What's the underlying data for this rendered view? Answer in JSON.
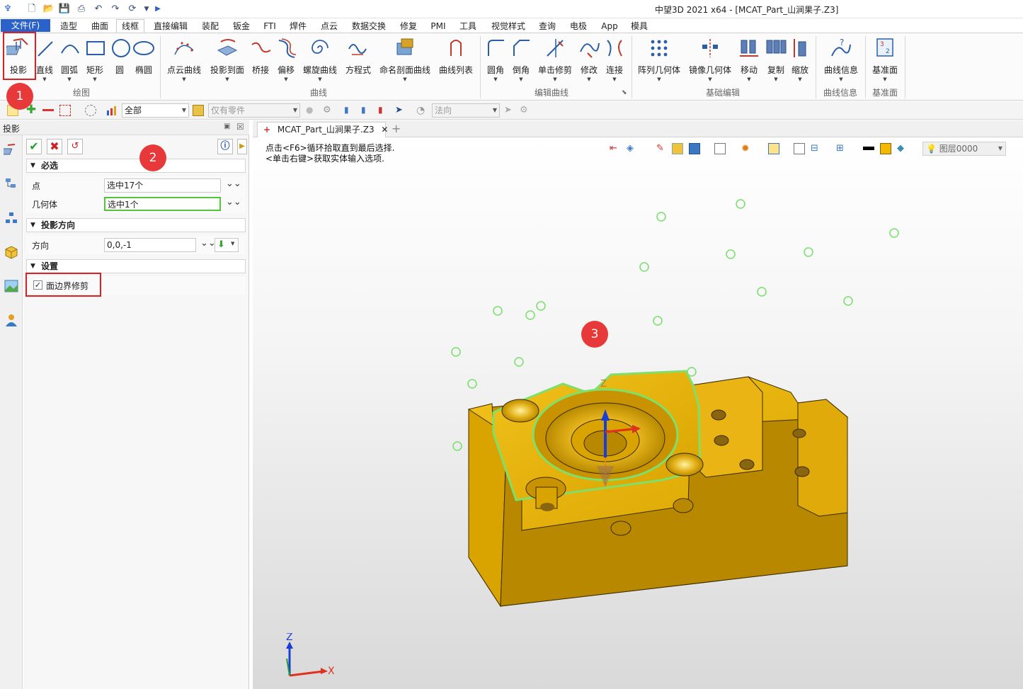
{
  "window": {
    "title": "中望3D 2021 x64 - [MCAT_Part_山涧果子.Z3]"
  },
  "menu": {
    "file": "文件(F)",
    "items": [
      "造型",
      "曲面",
      "线框",
      "直接编辑",
      "装配",
      "钣金",
      "FTI",
      "焊件",
      "点云",
      "数据交换",
      "修复",
      "PMI",
      "工具",
      "视觉样式",
      "查询",
      "电极",
      "App",
      "模具"
    ],
    "active": "线框"
  },
  "ribbon": {
    "groups": {
      "draw": {
        "label": "绘图",
        "buttons": [
          "投影",
          "直线",
          "圆弧",
          "矩形",
          "圆",
          "椭圆"
        ]
      },
      "curve": {
        "label": "曲线",
        "buttons": [
          "点云曲线",
          "投影到面",
          "桥接",
          "偏移",
          "螺旋曲线",
          "方程式",
          "命名剖面曲线",
          "曲线列表"
        ]
      },
      "edit": {
        "label": "编辑曲线",
        "buttons": [
          "圆角",
          "倒角",
          "单击修剪",
          "修改",
          "连接"
        ]
      },
      "basic": {
        "label": "基础编辑",
        "buttons": [
          "阵列几何体",
          "镜像几何体",
          "移动",
          "复制",
          "缩放"
        ]
      },
      "info": {
        "label": "曲线信息",
        "buttons": [
          "曲线信息"
        ]
      },
      "plane": {
        "label": "基准面",
        "buttons": [
          "基准面"
        ]
      }
    }
  },
  "toolbar": {
    "filter_value": "全部",
    "scope_value": "仅有零件",
    "direction_value": "法向"
  },
  "panel": {
    "title": "投影",
    "sections": {
      "required": "必选",
      "direction": "投影方向",
      "settings": "设置"
    },
    "fields": {
      "point_label": "点",
      "point_value": "选中17个",
      "geometry_label": "几何体",
      "geometry_value": "选中1个",
      "direction_label": "方向",
      "direction_value": "0,0,-1"
    },
    "trim_checkbox": {
      "label": "面边界修剪",
      "checked": true
    }
  },
  "document": {
    "tab_label": "MCAT_Part_山涧果子.Z3",
    "hint_line1": "点击<F6>循环拾取直到最后选择.",
    "hint_line2": "<单击右键>获取实体输入选项.",
    "layer": "图层0000",
    "triad": {
      "z": "Z",
      "x": "X"
    }
  },
  "annotations": [
    "1",
    "2",
    "3"
  ],
  "colors": {
    "accent": "#2a62c9",
    "part": "#d9a300",
    "selection": "#6ee05a",
    "callout": "#e8393a"
  }
}
